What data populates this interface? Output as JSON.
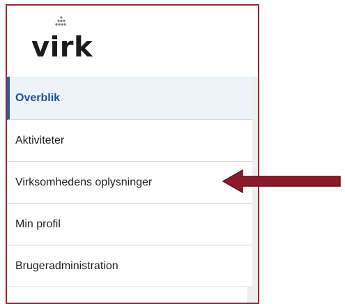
{
  "logo": {
    "text": "virk",
    "icon": "virk-logo-dots-icon"
  },
  "sidebar": {
    "items": [
      {
        "label": "Overblik",
        "active": true
      },
      {
        "label": "Aktiviteter",
        "active": false
      },
      {
        "label": "Virksomhedens oplysninger",
        "active": false
      },
      {
        "label": "Min profil",
        "active": false
      },
      {
        "label": "Brugeradministration",
        "active": false
      }
    ]
  },
  "annotation": {
    "icon": "arrow-left-icon",
    "color": "#8b1a2b"
  },
  "colors": {
    "frame_border": "#9b2335",
    "active_accent": "#1f5fa8",
    "active_background": "#eef3fa",
    "active_text": "#1f4f95"
  }
}
